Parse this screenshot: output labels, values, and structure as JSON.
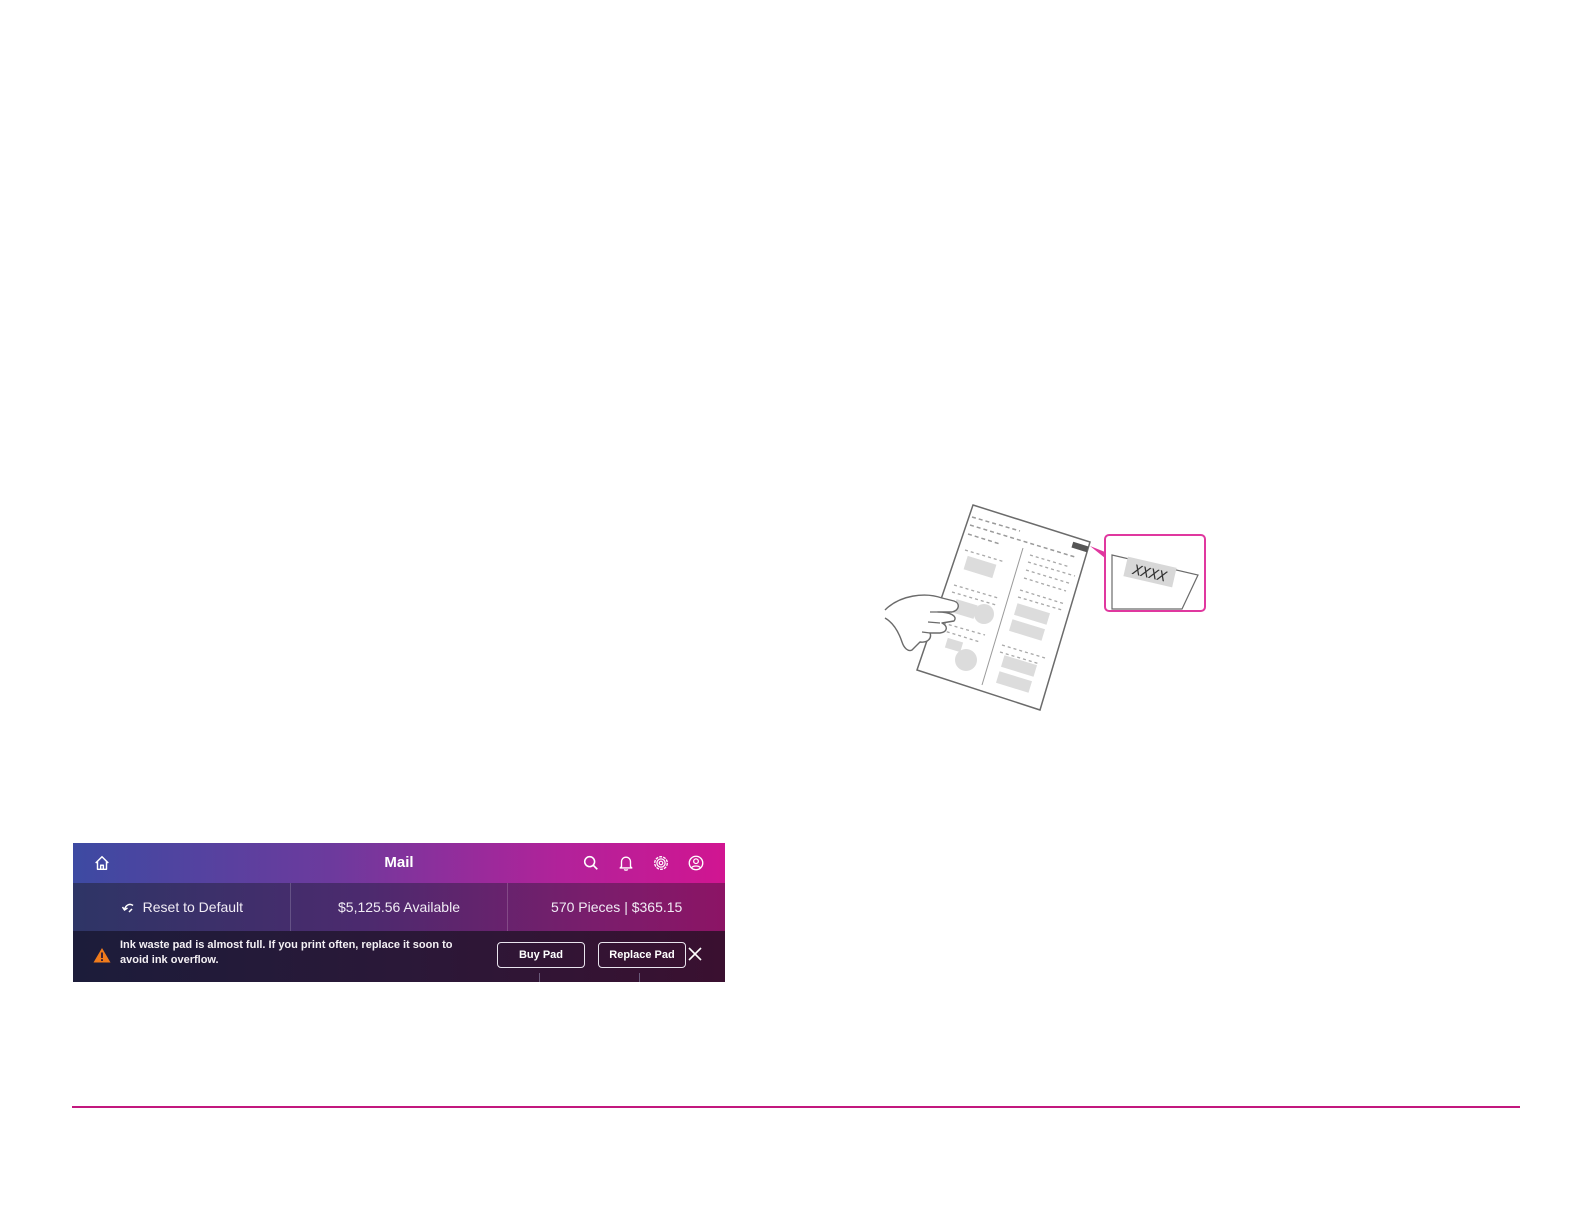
{
  "illustration": {
    "callout_text": "XXXX",
    "icons": [
      "hand-holding-report-icon"
    ],
    "accent_color": "#e0389f"
  },
  "device_ui": {
    "header": {
      "title": "Mail",
      "icons": [
        "home-icon",
        "search-icon",
        "bell-icon",
        "gear-icon",
        "account-icon"
      ]
    },
    "info_bar": {
      "reset_label": "Reset to Default",
      "available_label": "$5,125.56 Available",
      "pieces_label": "570 Pieces | $365.15"
    },
    "alert": {
      "message": "Ink waste pad is almost full. If you print often, replace it soon to avoid ink overflow.",
      "buy_button": "Buy Pad",
      "replace_button": "Replace Pad",
      "icon": "warning-icon"
    },
    "colors": {
      "gradient_start": "#3d4aa2",
      "gradient_end": "#d11591",
      "warning": "#f07b1c"
    }
  },
  "divider_color": "#c2187e"
}
